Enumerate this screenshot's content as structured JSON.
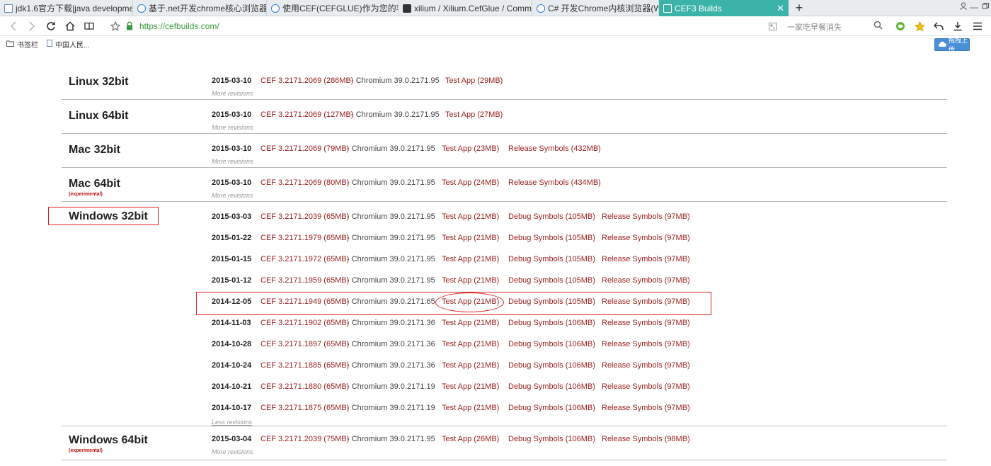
{
  "tabs": [
    {
      "title": "jdk1.6官方下载|java developme",
      "icon": "page-icon"
    },
    {
      "title": "基于.net开发chrome核心浏览器",
      "icon": "ie-icon"
    },
    {
      "title": "使用CEF(CEFGLUE)作为您的客户",
      "icon": "ie-icon"
    },
    {
      "title": "xilium / Xilium.CefGlue / Comm",
      "icon": "github-icon"
    },
    {
      "title": "C# 开发Chrome内核浏览器(Wel",
      "icon": "ie-icon"
    },
    {
      "title": "CEF3 Builds",
      "icon": "page-icon",
      "active": true
    }
  ],
  "address": {
    "url": "https://cefbuilds.com/",
    "search_placeholder": "一家吃早餐消失"
  },
  "bookmarks": [
    {
      "label": "书签栏"
    },
    {
      "label": "中国人民..."
    }
  ],
  "upload_label": "拖拽上传",
  "sections": [
    {
      "title": "Linux 32bit",
      "note": "",
      "builds": [
        {
          "date": "2015-03-10",
          "cef": "CEF 3.2171.2069 (286MB)",
          "chromium": "- Chromium 39.0.2171.95",
          "links": [
            "Test App (29MB)"
          ]
        }
      ],
      "revisions_link": "More revisions"
    },
    {
      "title": "Linux 64bit",
      "note": "",
      "builds": [
        {
          "date": "2015-03-10",
          "cef": "CEF 3.2171.2069 (127MB)",
          "chromium": "- Chromium 39.0.2171.95",
          "links": [
            "Test App (27MB)"
          ]
        }
      ],
      "revisions_link": "More revisions"
    },
    {
      "title": "Mac 32bit",
      "note": "",
      "builds": [
        {
          "date": "2015-03-10",
          "cef": "CEF 3.2171.2069 (79MB)",
          "chromium": "- Chromium 39.0.2171.95",
          "links": [
            "Test App (23MB)",
            "Release Symbols (432MB)"
          ]
        }
      ],
      "revisions_link": "More revisions"
    },
    {
      "title": "Mac 64bit",
      "note": "(experimental)",
      "builds": [
        {
          "date": "2015-03-10",
          "cef": "CEF 3.2171.2069 (80MB)",
          "chromium": "- Chromium 39.0.2171.95",
          "links": [
            "Test App (24MB)",
            "Release Symbols (434MB)"
          ]
        }
      ],
      "revisions_link": "More revisions"
    },
    {
      "title": "Windows 32bit",
      "note": "",
      "builds": [
        {
          "date": "2015-03-03",
          "cef": "CEF 3.2171.2039 (65MB)",
          "chromium": "- Chromium 39.0.2171.95",
          "links": [
            "Test App (21MB)",
            "Debug Symbols (105MB)",
            "Release Symbols (97MB)"
          ]
        },
        {
          "date": "2015-01-22",
          "cef": "CEF 3.2171.1979 (65MB)",
          "chromium": "- Chromium 39.0.2171.95",
          "links": [
            "Test App (21MB)",
            "Debug Symbols (105MB)",
            "Release Symbols (97MB)"
          ]
        },
        {
          "date": "2015-01-15",
          "cef": "CEF 3.2171.1972 (65MB)",
          "chromium": "- Chromium 39.0.2171.95",
          "links": [
            "Test App (21MB)",
            "Debug Symbols (105MB)",
            "Release Symbols (97MB)"
          ]
        },
        {
          "date": "2015-01-12",
          "cef": "CEF 3.2171.1959 (65MB)",
          "chromium": "- Chromium 39.0.2171.95",
          "links": [
            "Test App (21MB)",
            "Debug Symbols (105MB)",
            "Release Symbols (97MB)"
          ]
        },
        {
          "date": "2014-12-05",
          "cef": "CEF 3.2171.1949 (65MB)",
          "chromium": "- Chromium 39.0.2171.65",
          "links": [
            "Test App (21MB)",
            "Debug Symbols (105MB)",
            "Release Symbols (97MB)"
          ]
        },
        {
          "date": "2014-11-03",
          "cef": "CEF 3.2171.1902 (65MB)",
          "chromium": "- Chromium 39.0.2171.36",
          "links": [
            "Test App (21MB)",
            "Debug Symbols (106MB)",
            "Release Symbols (97MB)"
          ]
        },
        {
          "date": "2014-10-28",
          "cef": "CEF 3.2171.1897 (65MB)",
          "chromium": "- Chromium 39.0.2171.36",
          "links": [
            "Test App (21MB)",
            "Debug Symbols (106MB)",
            "Release Symbols (97MB)"
          ]
        },
        {
          "date": "2014-10-24",
          "cef": "CEF 3.2171.1885 (65MB)",
          "chromium": "- Chromium 39.0.2171.36",
          "links": [
            "Test App (21MB)",
            "Debug Symbols (106MB)",
            "Release Symbols (97MB)"
          ]
        },
        {
          "date": "2014-10-21",
          "cef": "CEF 3.2171.1880 (65MB)",
          "chromium": "- Chromium 39.0.2171.19",
          "links": [
            "Test App (21MB)",
            "Debug Symbols (106MB)",
            "Release Symbols (97MB)"
          ]
        },
        {
          "date": "2014-10-17",
          "cef": "CEF 3.2171.1875 (65MB)",
          "chromium": "- Chromium 39.0.2171.19",
          "links": [
            "Test App (21MB)",
            "Debug Symbols (106MB)",
            "Release Symbols (97MB)"
          ]
        }
      ],
      "revisions_link": "Less revisions"
    },
    {
      "title": "Windows 64bit",
      "note": "(experimental)",
      "builds": [
        {
          "date": "2015-03-04",
          "cef": "CEF 3.2171.2039 (75MB)",
          "chromium": "- Chromium 39.0.2171.95",
          "links": [
            "Test App (26MB)",
            "Debug Symbols (106MB)",
            "Release Symbols (98MB)"
          ]
        }
      ],
      "revisions_link": "More revisions"
    }
  ]
}
